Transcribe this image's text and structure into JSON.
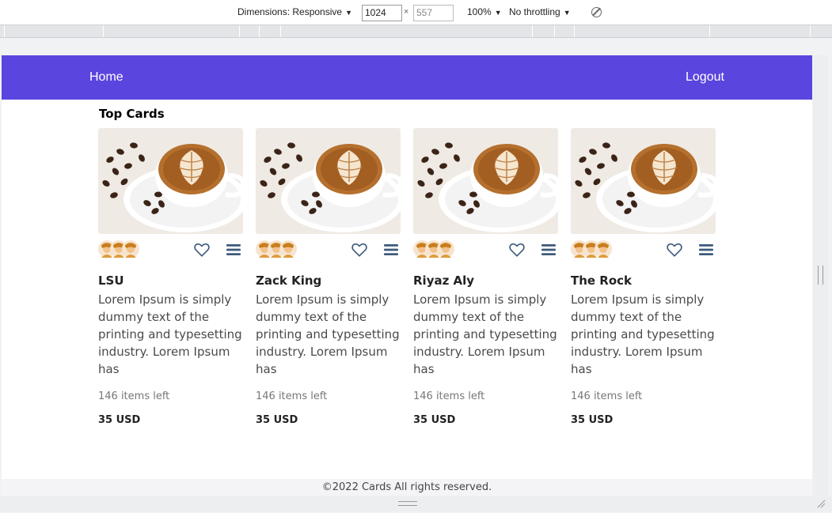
{
  "devtools": {
    "dimensions_label": "Dimensions: Responsive",
    "width_value": "1024",
    "times": "×",
    "height_value": "557",
    "zoom": "100%",
    "throttling": "No throttling",
    "caret": "▼"
  },
  "nav": {
    "home": "Home",
    "logout": "Logout",
    "bg_color": "#5b45df"
  },
  "section": {
    "title": "Top Cards"
  },
  "cards": [
    {
      "title": "LSU",
      "description": "Lorem Ipsum is simply dummy text of the printing and typesetting industry. Lorem Ipsum has",
      "stock": "146 items left",
      "price": "35 USD"
    },
    {
      "title": "Zack King",
      "description": "Lorem Ipsum is simply dummy text of the printing and typesetting industry. Lorem Ipsum has",
      "stock": "146 items left",
      "price": "35 USD"
    },
    {
      "title": "Riyaz Aly",
      "description": "Lorem Ipsum is simply dummy text of the printing and typesetting industry. Lorem Ipsum has",
      "stock": "146 items left",
      "price": "35 USD"
    },
    {
      "title": "The Rock",
      "description": "Lorem Ipsum is simply dummy text of the printing and typesetting industry. Lorem Ipsum has",
      "stock": "146 items left",
      "price": "35 USD"
    }
  ],
  "icons": {
    "card_image": "coffee-cup-icon",
    "avatar": "avatar-icon",
    "like": "heart-icon",
    "menu": "hamburger-menu-icon",
    "rotate": "rotate-icon"
  },
  "footer": {
    "text": "©2022 Cards All rights reserved."
  }
}
